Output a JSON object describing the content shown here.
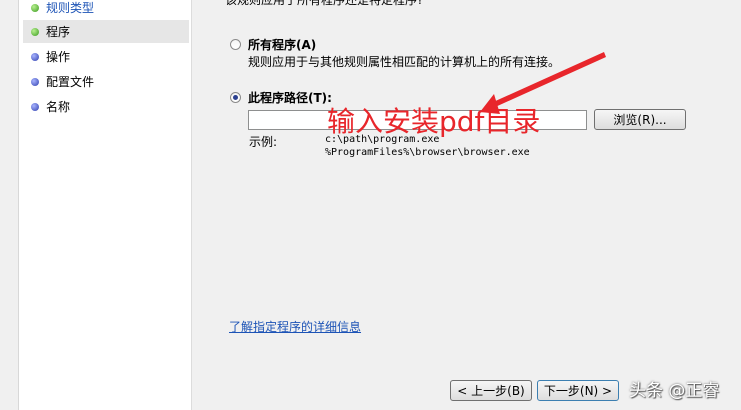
{
  "sidebar": {
    "items": [
      {
        "label": "规则类型",
        "dot": "green",
        "link": true,
        "selected": false
      },
      {
        "label": "程序",
        "dot": "green",
        "link": false,
        "selected": true
      },
      {
        "label": "操作",
        "dot": "blue",
        "link": false,
        "selected": false
      },
      {
        "label": "配置文件",
        "dot": "blue",
        "link": false,
        "selected": false
      },
      {
        "label": "名称",
        "dot": "blue",
        "link": false,
        "selected": false
      }
    ]
  },
  "main": {
    "question": "该规则应用于所有程序还是特定程序?",
    "all_programs": {
      "label": "所有程序(A)",
      "description": "规则应用于与其他规则属性相匹配的计算机上的所有连接。",
      "checked": false
    },
    "program_path": {
      "label": "此程序路径(T):",
      "checked": true,
      "value": "",
      "browse_label": "浏览(R)...",
      "example_label": "示例:",
      "example_lines": [
        "c:\\path\\program.exe",
        "%ProgramFiles%\\browser\\browser.exe"
      ]
    },
    "help_link": "了解指定程序的详细信息",
    "back_button": "< 上一步(B)",
    "next_button": "下一步(N) >"
  },
  "annotation": {
    "text": "输入安装pdf目录",
    "color": "#e8262b"
  },
  "watermark": "头条 @正睿",
  "colors": {
    "link": "#1c53b6",
    "annotation": "#e8262b"
  }
}
